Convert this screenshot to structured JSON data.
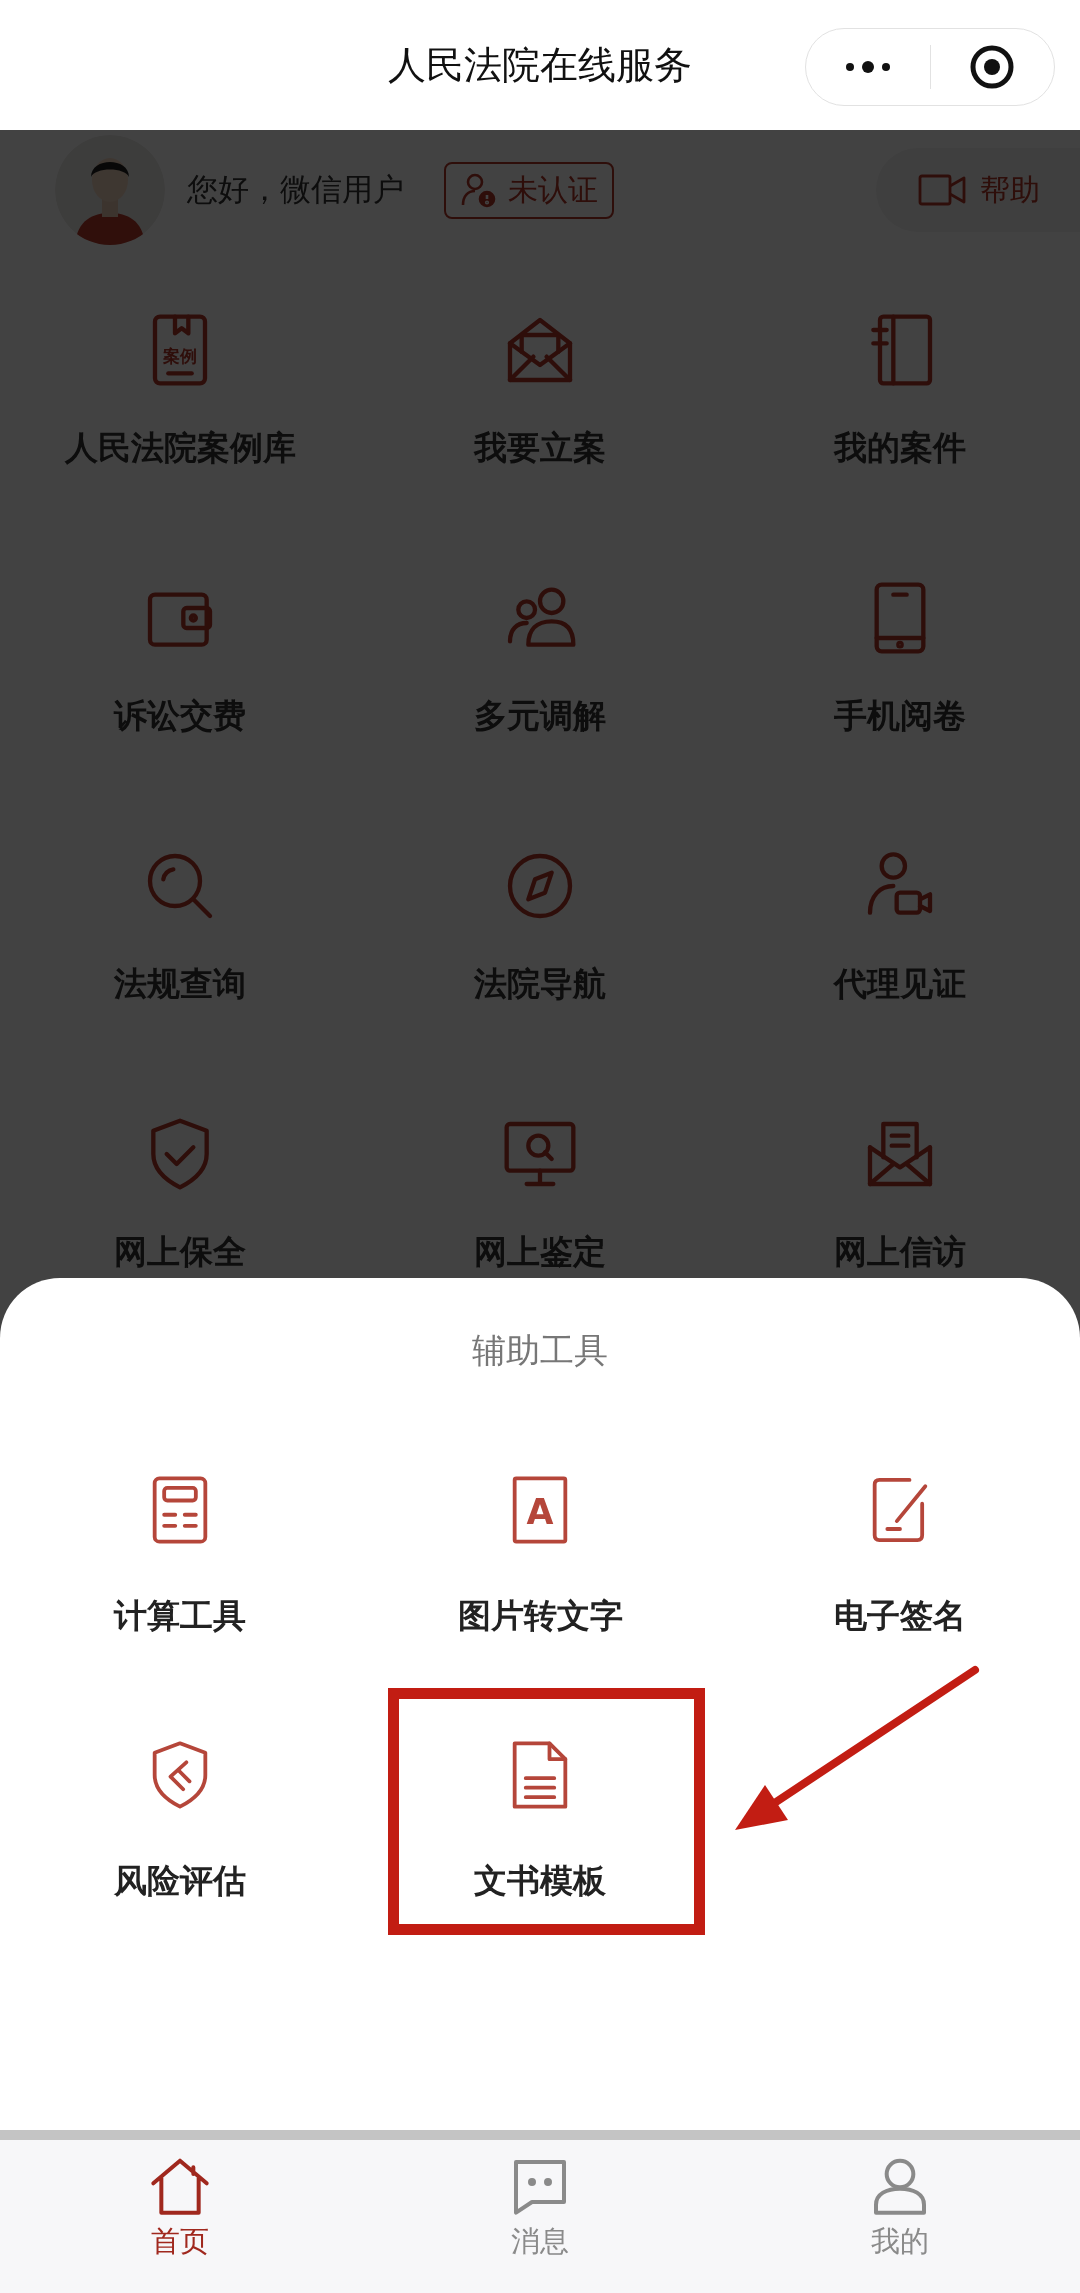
{
  "nav_bar": {
    "title": "人民法院在线服务"
  },
  "user": {
    "greeting": "您好，微信用户",
    "badge": "未认证",
    "help": "帮助"
  },
  "services": [
    {
      "label": "人民法院案例库",
      "icon_label": "案例"
    },
    {
      "label": "我要立案"
    },
    {
      "label": "我的案件"
    },
    {
      "label": "诉讼交费"
    },
    {
      "label": "多元调解"
    },
    {
      "label": "手机阅卷"
    },
    {
      "label": "法规查询"
    },
    {
      "label": "法院导航"
    },
    {
      "label": "代理见证"
    },
    {
      "label": "网上保全"
    },
    {
      "label": "网上鉴定"
    },
    {
      "label": "网上信访"
    }
  ],
  "tools_sheet": {
    "title": "辅助工具",
    "items": [
      {
        "label": "计算工具",
        "highlighted": false
      },
      {
        "label": "图片转文字",
        "icon_label": "A",
        "highlighted": false
      },
      {
        "label": "电子签名",
        "highlighted": false
      },
      {
        "label": "风险评估",
        "highlighted": false
      },
      {
        "label": "文书模板",
        "highlighted": true
      }
    ]
  },
  "tab_bar": [
    {
      "label": "首页",
      "selected": true
    },
    {
      "label": "消息",
      "selected": false
    },
    {
      "label": "我的",
      "selected": false
    }
  ]
}
